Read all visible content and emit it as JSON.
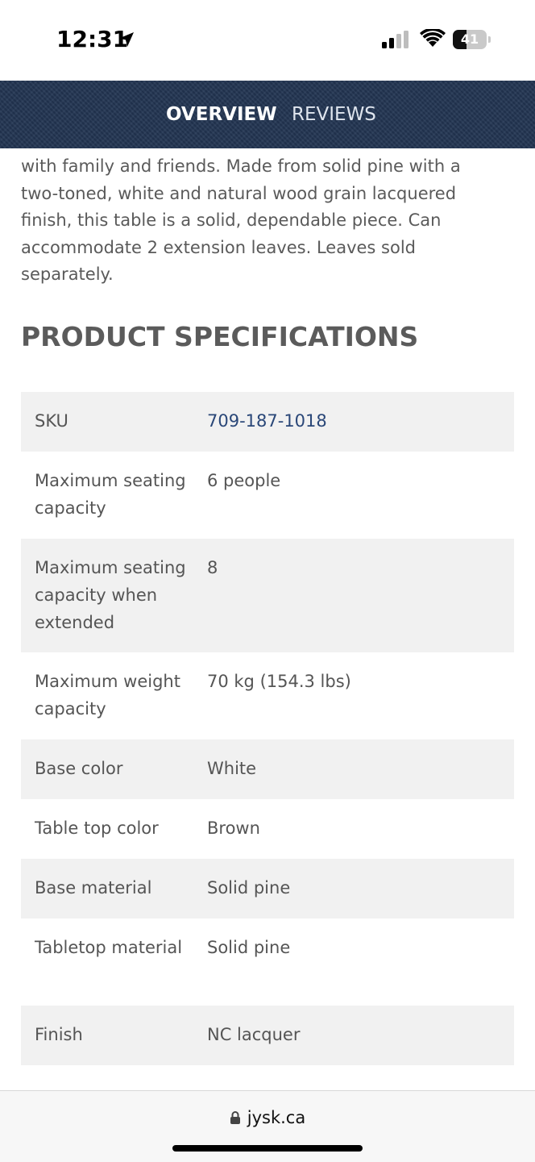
{
  "status_bar": {
    "time": "12:31",
    "battery_level": "41",
    "battery_fraction": 0.41,
    "icons": [
      "location-arrow-icon",
      "signal-icon",
      "wifi-icon",
      "battery-icon"
    ]
  },
  "tabs": [
    {
      "label": "OVERVIEW",
      "active": true
    },
    {
      "label": "REVIEWS",
      "active": false
    }
  ],
  "description": {
    "lines": [
      "with family and friends. Made from solid pine with a",
      "two-toned, white and natural wood grain lacquered",
      "finish, this table is a solid, dependable piece. Can",
      "accommodate 2 extension leaves. Leaves sold",
      "separately."
    ]
  },
  "specifications": {
    "heading": "PRODUCT SPECIFICATIONS",
    "rows": [
      {
        "label": "SKU",
        "value": "709-187-1018"
      },
      {
        "label": "Maximum seating capacity",
        "value": "6 people"
      },
      {
        "label": "Maximum seating capacity when extended",
        "value": "8"
      },
      {
        "label": "Maximum weight capacity",
        "value": "70 kg (154.3 lbs)"
      },
      {
        "label": "Base color",
        "value": "White"
      },
      {
        "label": "Table top color",
        "value": "Brown"
      },
      {
        "label": "Base material",
        "value": "Solid pine"
      },
      {
        "label": "Tabletop material",
        "value": "Solid pine"
      },
      {
        "label": "Finish",
        "value": "NC lacquer"
      }
    ]
  },
  "browser": {
    "url": "jysk.ca",
    "icons": [
      "lock-icon"
    ]
  },
  "colors": {
    "tab_bar": "#223552",
    "link": "#2a4778",
    "row_shade": "#f1f1f1"
  }
}
